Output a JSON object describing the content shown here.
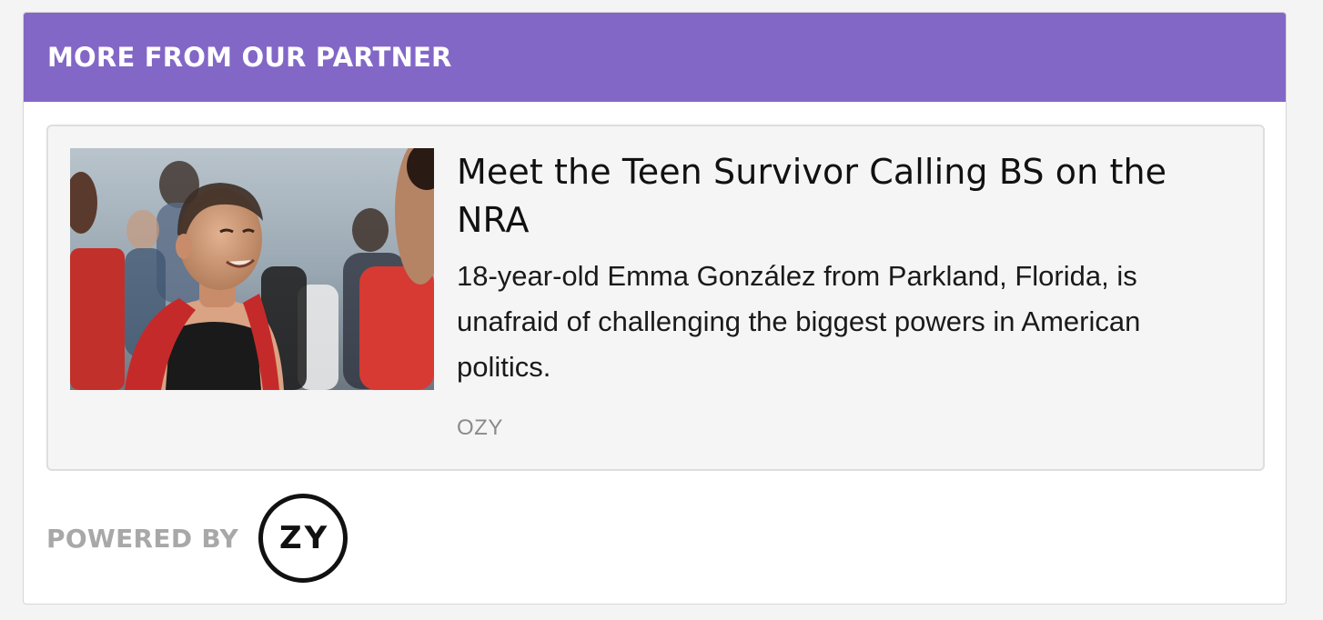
{
  "header": {
    "title": "MORE FROM OUR PARTNER",
    "background_color": "#8267c7"
  },
  "card": {
    "image_alt": "Photo of a smiling young woman with a shaved head and a red backpack in a crowd",
    "title": "Meet the Teen Survivor Calling BS on the NRA",
    "description": "18-year-old Emma González from Parkland, Florida, is unafraid of challenging the biggest powers in American politics.",
    "source": "OZY"
  },
  "footer": {
    "powered_by_label": "POWERED BY",
    "logo_text": "ZY"
  }
}
